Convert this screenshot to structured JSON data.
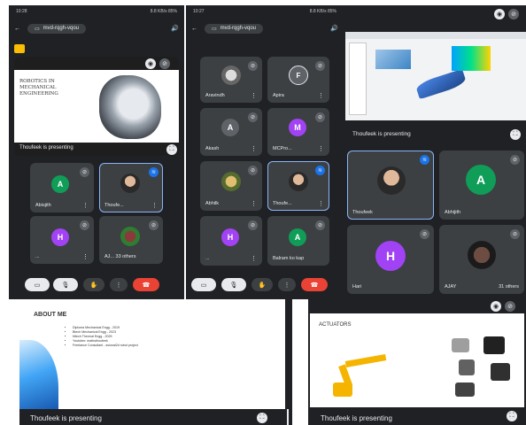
{
  "colors": {
    "panel_bg": "#202124",
    "tile_bg": "#3c4043",
    "avatar_teal": "#0f9d58",
    "avatar_blue": "#5f6368",
    "avatar_purple": "#a142f4",
    "end_call_red": "#ea4335",
    "active_outline": "#8ab4f8"
  },
  "phone1": {
    "status": {
      "time": "10:28",
      "battery": "8.8 KB/s  85%"
    },
    "meeting_code": "mvd-rqgh-vqou",
    "slide": {
      "title": "ROBOTICS IN MECHANICAL ENGINEERING"
    },
    "presenter_text": "Thoufeek is presenting",
    "tiles": [
      {
        "name": "Abisjith",
        "initial": "A"
      },
      {
        "name": "Thoufe...",
        "initial": ""
      },
      {
        "name": "...",
        "initial": "H"
      },
      {
        "name": "AJ... 33 others",
        "initial": ""
      }
    ]
  },
  "phone2": {
    "status": {
      "time": "10:27",
      "battery": "8.8 KB/s  85%"
    },
    "meeting_code": "mvd-rqgh-vqou",
    "tiles": [
      {
        "name": "Aravindh",
        "initial": ""
      },
      {
        "name": "Apira",
        "initial": "F"
      },
      {
        "name": "Akash",
        "initial": "A"
      },
      {
        "name": "MCPro...",
        "initial": "M"
      },
      {
        "name": "Abhilk",
        "initial": ""
      },
      {
        "name": "Thoufe...",
        "initial": ""
      },
      {
        "name": "...",
        "initial": "H"
      },
      {
        "name": "Balram ko kap",
        "initial": "A"
      }
    ]
  },
  "desktop": {
    "presenter_text": "Thoufeek is presenting",
    "tiles": [
      {
        "name": "Thoufeek",
        "initial": ""
      },
      {
        "name": "Abhijith",
        "initial": "A"
      },
      {
        "name": "Hari",
        "initial": "H"
      },
      {
        "name": "AJAY",
        "initial": "",
        "others": "31 others"
      }
    ]
  },
  "about_slide": {
    "title": "ABOUT ME",
    "items": [
      "Diploma Mechanical Engg - 2019",
      "Btech Mechanical Engg - 2023",
      "Mtech Thermal Engg - 2025",
      "Youtuber: mathsthoufeek",
      "Freelance Consultant - avional2d robot project"
    ],
    "presenter_text": "Thoufeek is presenting"
  },
  "actuators_slide": {
    "title": "ACTUATORS",
    "presenter_text": "Thoufeek is presenting"
  }
}
